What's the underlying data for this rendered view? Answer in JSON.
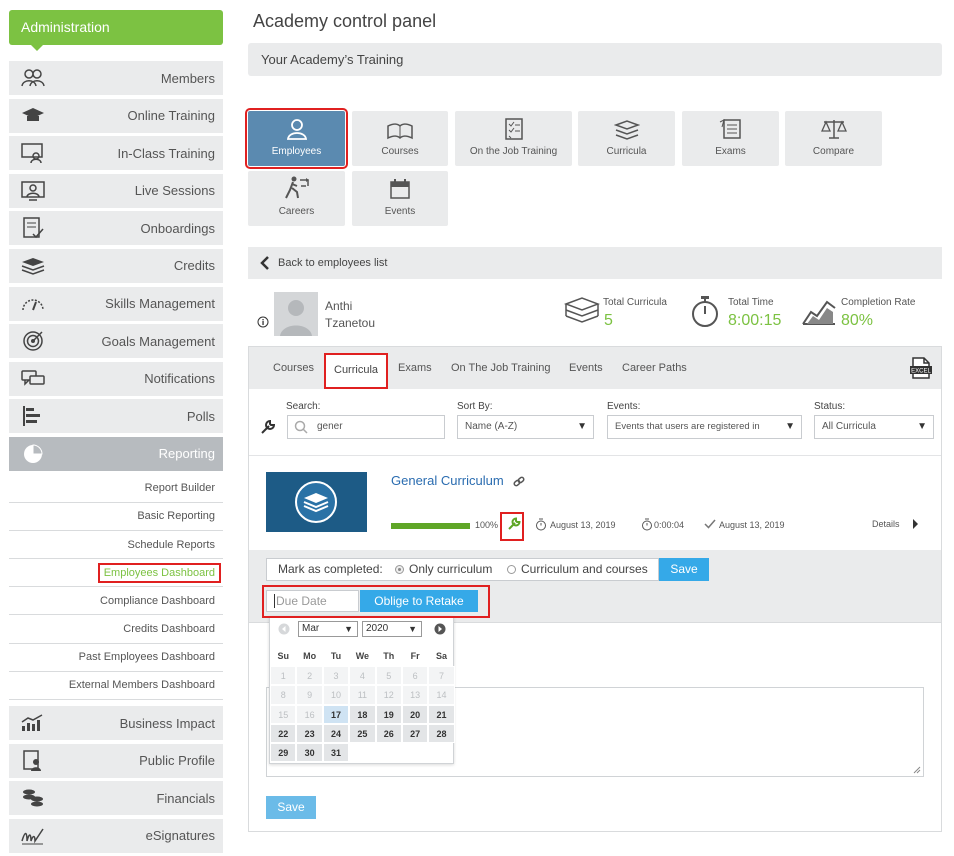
{
  "sidebar": {
    "header": "Administration",
    "items": [
      {
        "label": "Members",
        "icon": "members-icon"
      },
      {
        "label": "Online Training",
        "icon": "graduation-cap-icon"
      },
      {
        "label": "In-Class Training",
        "icon": "classroom-icon"
      },
      {
        "label": "Live Sessions",
        "icon": "live-sessions-icon"
      },
      {
        "label": "Onboardings",
        "icon": "onboarding-icon"
      },
      {
        "label": "Credits",
        "icon": "credits-stack-icon"
      },
      {
        "label": "Skills Management",
        "icon": "gauge-icon"
      },
      {
        "label": "Goals Management",
        "icon": "target-icon"
      },
      {
        "label": "Notifications",
        "icon": "chat-icon"
      },
      {
        "label": "Polls",
        "icon": "poll-bars-icon"
      },
      {
        "label": "Reporting",
        "icon": "pie-chart-icon"
      }
    ],
    "reporting_sub": [
      "Report Builder",
      "Basic Reporting",
      "Schedule Reports",
      "Employees Dashboard",
      "Compliance Dashboard",
      "Credits Dashboard",
      "Past Employees Dashboard",
      "External Members Dashboard"
    ],
    "items_after": [
      {
        "label": "Business Impact",
        "icon": "trend-chart-icon"
      },
      {
        "label": "Public Profile",
        "icon": "profile-icon"
      },
      {
        "label": "Financials",
        "icon": "coins-icon"
      },
      {
        "label": "eSignatures",
        "icon": "signature-icon"
      }
    ]
  },
  "main": {
    "title": "Academy control panel",
    "subtitle": "Your Academy’s Training",
    "tiles": [
      "Employees",
      "Courses",
      "On the Job Training",
      "Curricula",
      "Exams",
      "Compare",
      "Careers",
      "Events"
    ],
    "back_label": "Back to employees list",
    "employee": {
      "first": "Anthi",
      "last": "Tzanetou"
    },
    "stats": {
      "total_curricula_label": "Total Curricula",
      "total_curricula": "5",
      "total_time_label": "Total Time",
      "total_time": "8:00:15",
      "completion_rate_label": "Completion Rate",
      "completion_rate": "80%"
    },
    "tabs": [
      "Courses",
      "Curricula",
      "Exams",
      "On The Job Training",
      "Events",
      "Career Paths"
    ],
    "filters": {
      "search_label": "Search:",
      "search_value": "gener",
      "sort_label": "Sort By:",
      "sort_value": "Name (A-Z)",
      "events_label": "Events:",
      "events_value": "Events that users are registered in",
      "status_label": "Status:",
      "status_value": "All Curricula"
    },
    "curriculum": {
      "name": "General Curriculum",
      "progress_text": "100%",
      "progress": 1.0,
      "start_date": "August 13, 2019",
      "time": "0:00:04",
      "completed_date": "August 13, 2019",
      "details": "Details"
    },
    "mark": {
      "label": "Mark as completed:",
      "opt1": "Only curriculum",
      "opt2": "Curriculum and courses",
      "save": "Save"
    },
    "due_date_placeholder": "Due Date",
    "oblige_label": "Oblige to Retake",
    "calendar": {
      "month": "Mar",
      "year": "2020",
      "weekdays": [
        "Su",
        "Mo",
        "Tu",
        "We",
        "Th",
        "Fr",
        "Sa"
      ],
      "weeks": [
        [
          "1",
          "2",
          "3",
          "4",
          "5",
          "6",
          "7"
        ],
        [
          "8",
          "9",
          "10",
          "11",
          "12",
          "13",
          "14"
        ],
        [
          "15",
          "16",
          "17",
          "18",
          "19",
          "20",
          "21"
        ],
        [
          "22",
          "23",
          "24",
          "25",
          "26",
          "27",
          "28"
        ],
        [
          "29",
          "30",
          "31",
          "",
          "",
          "",
          ""
        ]
      ],
      "today": "17",
      "first_enabled": 17
    },
    "bottom_save": "Save"
  },
  "colors": {
    "accent_green": "#7cc242",
    "selected_blue": "#5b8ab0",
    "button_blue": "#35a9e8",
    "highlight_red": "#e02020"
  }
}
